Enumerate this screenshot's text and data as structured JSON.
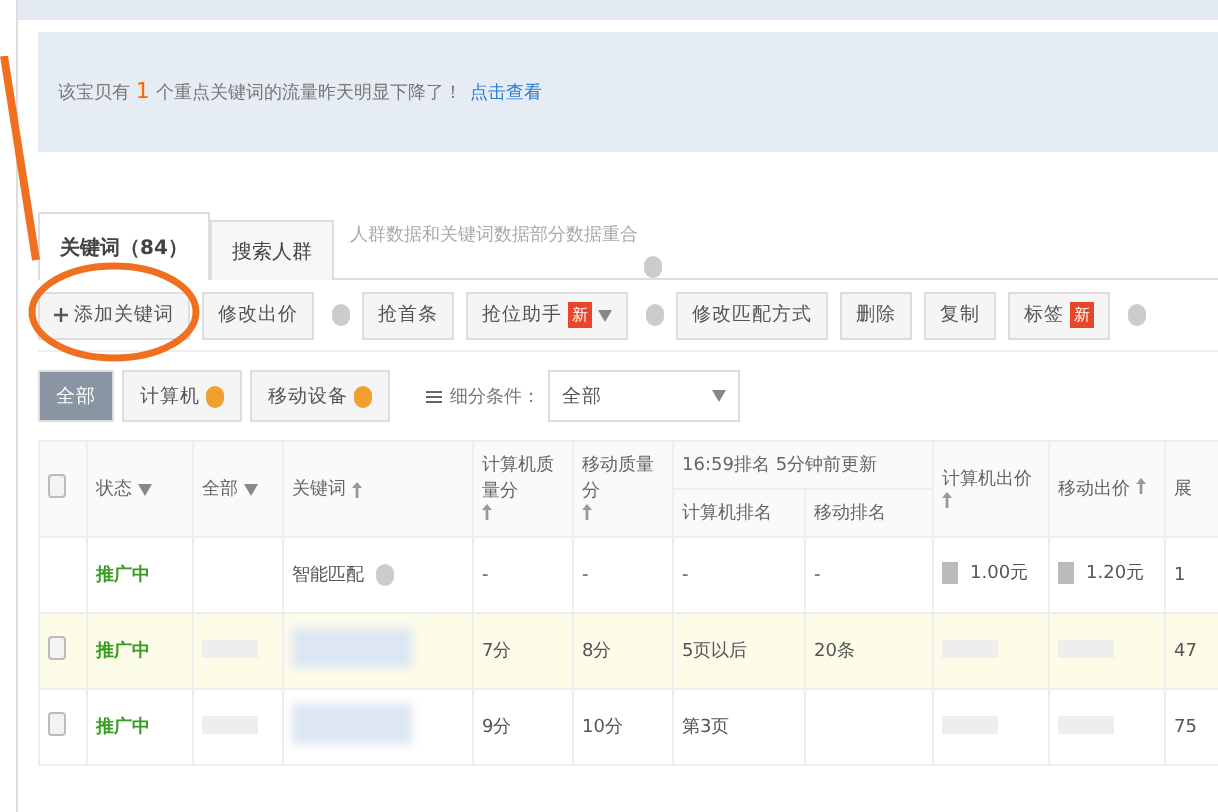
{
  "notice": {
    "before": "该宝贝有",
    "count": "1",
    "after": "个重点关键词的流量昨天明显下降了！",
    "link": "点击查看"
  },
  "tabs": [
    {
      "label": "关键词（84）",
      "selected": true
    },
    {
      "label": "搜索人群",
      "selected": false
    }
  ],
  "tabs_note": "人群数据和关键词数据部分数据重合",
  "toolbar": [
    {
      "label": "修改出价",
      "help": true
    },
    {
      "label": "抢首条",
      "help": false
    },
    {
      "label": "抢位助手",
      "help": true,
      "badge": "新",
      "dropdown": true
    },
    {
      "label": "修改匹配方式",
      "help": false
    },
    {
      "label": "删除",
      "help": false
    },
    {
      "label": "复制",
      "help": false
    },
    {
      "label": "标签",
      "help": true,
      "badge": "新"
    }
  ],
  "add_button": "添加关键词",
  "devices": [
    {
      "label": "全部",
      "selected": true,
      "help": false
    },
    {
      "label": "计算机",
      "selected": false,
      "help": true
    },
    {
      "label": "移动设备",
      "selected": false,
      "help": true
    }
  ],
  "filter": {
    "label": "细分条件：",
    "value": "全部"
  },
  "header_checkbox": {
    "checked": false
  },
  "columns": {
    "status": "状态",
    "all": "全部",
    "keyword": "关键词",
    "pc_quality": "计算机质量分",
    "m_quality": "移动质量分",
    "rank_time": "16:59排名",
    "rank_update": "5分钟前更新",
    "pc_rank": "计算机排名",
    "m_rank": "移动排名",
    "pc_bid": "计算机出价",
    "m_bid": "移动出价",
    "column_11": "展"
  },
  "rows": [
    {
      "kind": "smart",
      "status": "推广中",
      "keyword": "智能匹配",
      "pc_quality": "-",
      "m_quality": "-",
      "pc_rank": "-",
      "m_rank": "-",
      "pc_bid": "1.00元",
      "m_bid": "1.20元",
      "column_11": "1",
      "highlight": false
    },
    {
      "kind": "keyword",
      "checked": false,
      "status": "推广中",
      "pc_quality": "7分",
      "m_quality": "8分",
      "pc_rank": "5页以后",
      "m_rank": "20条",
      "column_11": "47",
      "highlight": true
    },
    {
      "kind": "keyword",
      "checked": false,
      "status": "推广中",
      "pc_quality": "9分",
      "m_quality": "10分",
      "pc_rank": "第3页",
      "column_11": "75",
      "highlight": false
    }
  ]
}
